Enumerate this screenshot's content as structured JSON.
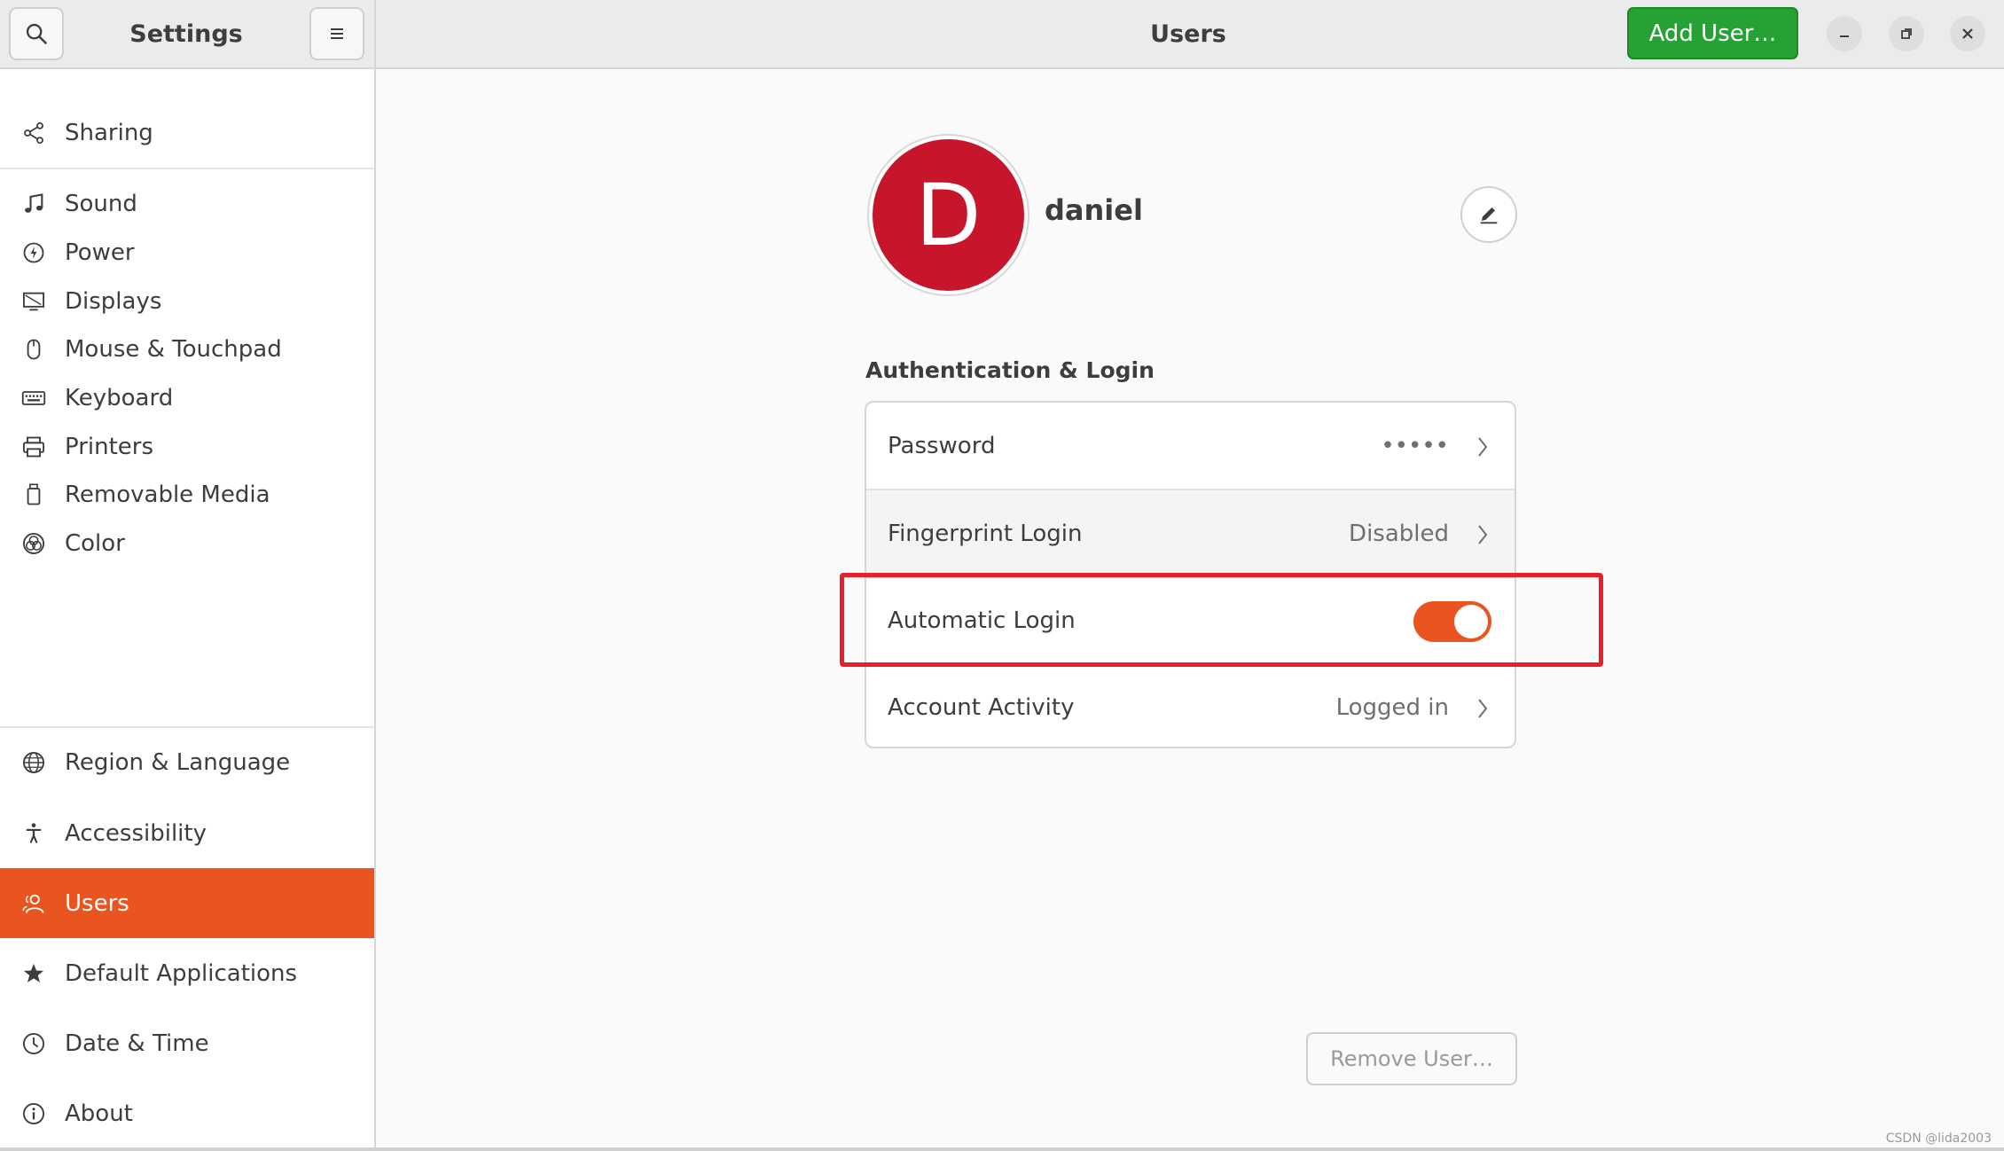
{
  "header": {
    "app_title": "Settings",
    "page_title": "Users",
    "add_user_label": "Add User…"
  },
  "window_controls": {
    "minimize": "–",
    "maximize": "◻",
    "close": "✕"
  },
  "sidebar": {
    "items": [
      {
        "label": "Sharing",
        "icon": "share-icon"
      },
      {
        "label": "Sound",
        "icon": "music-note-icon"
      },
      {
        "label": "Power",
        "icon": "power-icon"
      },
      {
        "label": "Displays",
        "icon": "display-icon"
      },
      {
        "label": "Mouse & Touchpad",
        "icon": "mouse-icon"
      },
      {
        "label": "Keyboard",
        "icon": "keyboard-icon"
      },
      {
        "label": "Printers",
        "icon": "printer-icon"
      },
      {
        "label": "Removable Media",
        "icon": "removable-media-icon"
      },
      {
        "label": "Color",
        "icon": "color-icon"
      },
      {
        "label": "Region & Language",
        "icon": "globe-icon"
      },
      {
        "label": "Accessibility",
        "icon": "accessibility-icon"
      },
      {
        "label": "Users",
        "icon": "users-icon",
        "active": true
      },
      {
        "label": "Default Applications",
        "icon": "star-icon"
      },
      {
        "label": "Date & Time",
        "icon": "clock-icon"
      },
      {
        "label": "About",
        "icon": "info-icon"
      }
    ]
  },
  "user": {
    "avatar_letter": "D",
    "name": "daniel"
  },
  "auth": {
    "heading": "Authentication & Login",
    "password_label": "Password",
    "password_value": "•••••",
    "fingerprint_label": "Fingerprint Login",
    "fingerprint_value": "Disabled",
    "autologin_label": "Automatic Login",
    "autologin_enabled": true,
    "activity_label": "Account Activity",
    "activity_value": "Logged in"
  },
  "remove_user_label": "Remove User…",
  "watermark": "CSDN @lida2003",
  "colors": {
    "accent": "#e95420",
    "add_user_green": "#26a235",
    "avatar_red": "#c7162b",
    "highlight_red": "#e8202a"
  }
}
